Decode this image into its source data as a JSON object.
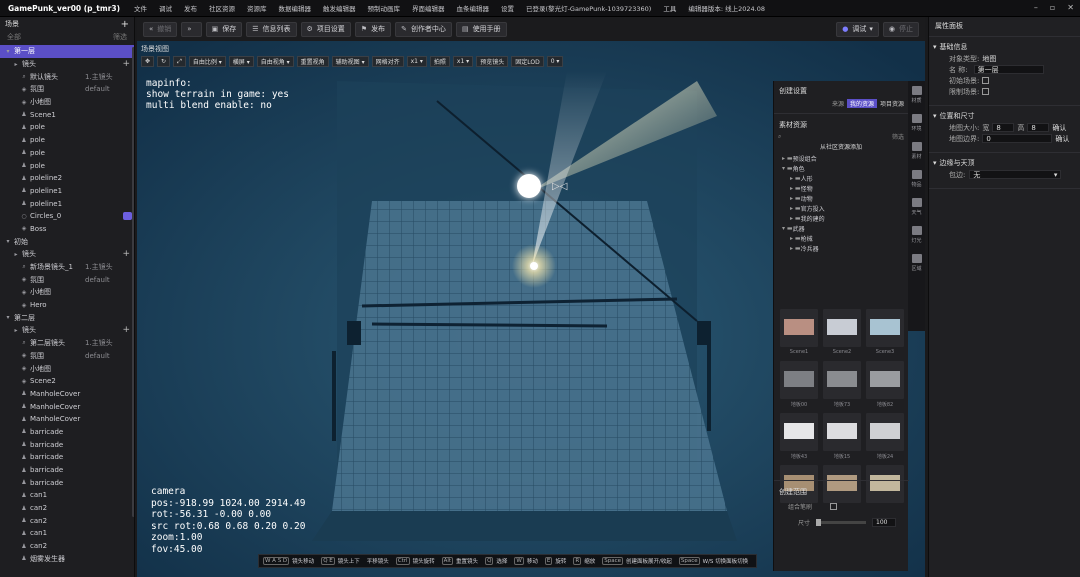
{
  "app": {
    "title": "GamePunk_ver00 (p_tmr3)"
  },
  "menu": [
    "文件",
    "调试",
    "发布",
    "社区资源",
    "资源库",
    "数据编辑器",
    "触发编辑器",
    "预制动画库",
    "界面编辑器",
    "血条编辑器",
    "设置",
    "已登录(黎光灯-GamePunk-1039723360)",
    "工具",
    "编辑器版本: 线上2024.08"
  ],
  "left": {
    "title": "场景",
    "search": "全部",
    "filter": "筛选",
    "rows": [
      {
        "label": "第一层",
        "indent": 0,
        "sel": true,
        "icon": "▾",
        "extra": ""
      },
      {
        "label": "镜头",
        "indent": 1,
        "icon": "▸",
        "extra": "",
        "plus": true
      },
      {
        "label": "默认镜头",
        "indent": 2,
        "icon": "⌕",
        "extra": "1.主镜头"
      },
      {
        "label": "氛围",
        "indent": 2,
        "icon": "◈",
        "extra": "default"
      },
      {
        "label": "小地图",
        "indent": 2,
        "icon": "◈",
        "extra": ""
      },
      {
        "label": "Scene1",
        "indent": 2,
        "icon": "♟",
        "extra": ""
      },
      {
        "label": "pole",
        "indent": 2,
        "icon": "♟",
        "extra": ""
      },
      {
        "label": "pole",
        "indent": 2,
        "icon": "♟",
        "extra": ""
      },
      {
        "label": "pole",
        "indent": 2,
        "icon": "♟",
        "extra": ""
      },
      {
        "label": "pole",
        "indent": 2,
        "icon": "♟",
        "extra": ""
      },
      {
        "label": "poleline2",
        "indent": 2,
        "icon": "♟",
        "extra": ""
      },
      {
        "label": "poleline1",
        "indent": 2,
        "icon": "♟",
        "extra": ""
      },
      {
        "label": "poleline1",
        "indent": 2,
        "icon": "♟",
        "extra": ""
      },
      {
        "label": "Circles_0",
        "indent": 2,
        "icon": "○",
        "extra": "",
        "eye": true
      },
      {
        "label": "Boss",
        "indent": 2,
        "icon": "◈",
        "extra": ""
      },
      {
        "label": "初始",
        "indent": 0,
        "icon": "▾",
        "extra": ""
      },
      {
        "label": "镜头",
        "indent": 1,
        "icon": "▸",
        "extra": "",
        "plus": true
      },
      {
        "label": "新场景镜头_1",
        "indent": 2,
        "icon": "⌕",
        "extra": "1.主镜头"
      },
      {
        "label": "氛围",
        "indent": 2,
        "icon": "◈",
        "extra": "default"
      },
      {
        "label": "小地图",
        "indent": 2,
        "icon": "◈",
        "extra": ""
      },
      {
        "label": "Hero",
        "indent": 2,
        "icon": "◈",
        "extra": ""
      },
      {
        "label": "第二层",
        "indent": 0,
        "icon": "▾",
        "extra": ""
      },
      {
        "label": "镜头",
        "indent": 1,
        "icon": "▸",
        "extra": "",
        "plus": true
      },
      {
        "label": "第二层镜头",
        "indent": 2,
        "icon": "⌕",
        "extra": "1.主镜头"
      },
      {
        "label": "氛围",
        "indent": 2,
        "icon": "◈",
        "extra": "default"
      },
      {
        "label": "小地图",
        "indent": 2,
        "icon": "◈",
        "extra": ""
      },
      {
        "label": "Scene2",
        "indent": 2,
        "icon": "◈",
        "extra": ""
      },
      {
        "label": "ManholeCover",
        "indent": 2,
        "icon": "♟",
        "extra": ""
      },
      {
        "label": "ManholeCover",
        "indent": 2,
        "icon": "♟",
        "extra": ""
      },
      {
        "label": "ManholeCover",
        "indent": 2,
        "icon": "♟",
        "extra": ""
      },
      {
        "label": "barricade",
        "indent": 2,
        "icon": "♟",
        "extra": ""
      },
      {
        "label": "barricade",
        "indent": 2,
        "icon": "♟",
        "extra": ""
      },
      {
        "label": "barricade",
        "indent": 2,
        "icon": "♟",
        "extra": ""
      },
      {
        "label": "barricade",
        "indent": 2,
        "icon": "♟",
        "extra": ""
      },
      {
        "label": "barricade",
        "indent": 2,
        "icon": "♟",
        "extra": ""
      },
      {
        "label": "can1",
        "indent": 2,
        "icon": "♟",
        "extra": ""
      },
      {
        "label": "can2",
        "indent": 2,
        "icon": "♟",
        "extra": ""
      },
      {
        "label": "can2",
        "indent": 2,
        "icon": "♟",
        "extra": ""
      },
      {
        "label": "can1",
        "indent": 2,
        "icon": "♟",
        "extra": ""
      },
      {
        "label": "can2",
        "indent": 2,
        "icon": "♟",
        "extra": ""
      },
      {
        "label": "烟雾发生器",
        "indent": 2,
        "icon": "♟",
        "extra": ""
      }
    ]
  },
  "toolbar": {
    "undo": "撤销",
    "redo": "",
    "save": "保存",
    "info": "信息列表",
    "project": "项目设置",
    "publish": "发布",
    "creator": "创作者中心",
    "manual": "使用手册",
    "debug": "调试",
    "stop": "停止"
  },
  "viewport": {
    "label": "场景视图",
    "tools": [
      "自由比例 ▾",
      "横屏 ▾",
      "自由视角 ▾",
      "重置视角",
      "辅助视图 ▾",
      "网格对齐",
      "x1 ▾",
      "拍照",
      "x1 ▾",
      "预览镜头",
      "固定LOD",
      "0 ▾"
    ],
    "mapinfo": "mapinfo:\nshow terrain in game: yes\nmulti blend enable: no",
    "camera": "camera\npos:-918.99 1024.00 2914.49\nrot:-56.31 -0.00 0.00\nsrc rot:0.68 0.68 0.20 0.20\nzoom:1.00\nfov:45.00",
    "hotkeys": [
      [
        "W A S D",
        "镜头移动"
      ],
      [
        "Q E",
        "镜头上下"
      ],
      [
        "",
        "平移镜头"
      ],
      [
        "Ctrl",
        "镜头旋转"
      ],
      [
        "Alt",
        "重置镜头"
      ],
      [
        "Q",
        "选择"
      ],
      [
        "W",
        "移动"
      ],
      [
        "E",
        "旋转"
      ],
      [
        "R",
        "缩放"
      ],
      [
        "Space",
        "创建面板展开/收起"
      ],
      [
        "Space",
        "W/S 切换面板切换"
      ]
    ]
  },
  "assets": {
    "create": "创建设置",
    "source": "来源",
    "mine": "我的资源",
    "project": "项目资源",
    "material": "素材资源",
    "filter": "筛选",
    "add": "从社区资源添加",
    "tree": [
      [
        "▸",
        "预设组合",
        0
      ],
      [
        "▾",
        "角色",
        0
      ],
      [
        "▸",
        "人形",
        1
      ],
      [
        "▸",
        "怪物",
        1
      ],
      [
        "▸",
        "动物",
        1
      ],
      [
        "▸",
        "官方投入",
        1
      ],
      [
        "▸",
        "我的建的",
        1
      ],
      [
        "▾",
        "武器",
        0
      ],
      [
        "▸",
        "枪械",
        1
      ],
      [
        "▸",
        "冷兵器",
        1
      ]
    ],
    "thumbs": [
      [
        "Scene1",
        "#b98f82"
      ],
      [
        "Scene2",
        "#c8ccd4"
      ],
      [
        "Scene3",
        "#a8c3d2"
      ],
      [
        "地板00",
        "#7d7f84"
      ],
      [
        "地板73",
        "#8a8c90"
      ],
      [
        "地板82",
        "#9a9ca0"
      ],
      [
        "地板43",
        "#e6e6e8"
      ],
      [
        "地板15",
        "#dcdcdf"
      ],
      [
        "地板24",
        "#cfd0d3"
      ],
      [
        "",
        "#a78f73"
      ],
      [
        "",
        "#b09a80"
      ],
      [
        "",
        "#c2b79d"
      ]
    ],
    "range": "创建范围",
    "combine": "组合笔刷",
    "size": "尺寸",
    "size_val": "100",
    "side": [
      "材质",
      "环境",
      "素材",
      "物品",
      "天气",
      "灯光",
      "区域"
    ]
  },
  "right": {
    "title": "属性面板",
    "basic": "基础信息",
    "objtype_l": "对象类型:",
    "objtype": "地图",
    "name_l": "名 称:",
    "name": "第一层",
    "init_l": "初始场景:",
    "limit_l": "限制场景:",
    "pos": "位置和尺寸",
    "msize_l": "地图大小:",
    "w_l": "宽",
    "w": "8",
    "h_l": "高",
    "h": "8",
    "ok": "确认",
    "border_l": "地图边界:",
    "border": "0",
    "ok2": "确认",
    "edge": "边缘与天顶",
    "wrap_l": "包边:",
    "wrap": "无"
  }
}
